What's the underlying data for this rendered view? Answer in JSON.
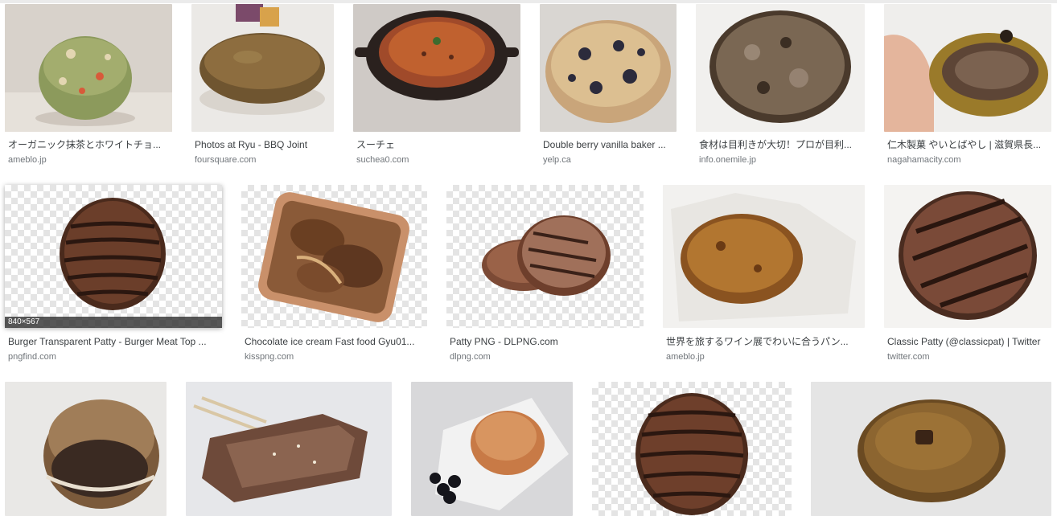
{
  "results": {
    "row1": [
      {
        "title": "オーガニック抹茶とホワイトチョ...",
        "domain": "ameblo.jp"
      },
      {
        "title": "Photos at Ryu - BBQ Joint",
        "domain": "foursquare.com"
      },
      {
        "title": "スーチェ",
        "domain": "suchea0.com"
      },
      {
        "title": "Double berry vanilla baker ...",
        "domain": "yelp.ca"
      },
      {
        "title": "食材は目利きが大切！プロが目利...",
        "domain": "info.onemile.jp"
      },
      {
        "title": "仁木製菓 やいとばやし | 滋賀県長...",
        "domain": "nagahamacity.com"
      }
    ],
    "row2": [
      {
        "title": "Burger Transparent Patty - Burger Meat Top ...",
        "domain": "pngfind.com",
        "dims": "840×567"
      },
      {
        "title": "Chocolate ice cream Fast food Gyu01...",
        "domain": "kisspng.com"
      },
      {
        "title": "Patty PNG - DLPNG.com",
        "domain": "dlpng.com"
      },
      {
        "title": "世界を旅するワイン展でわいに合うパン...",
        "domain": "ameblo.jp"
      },
      {
        "title": "Classic Patty (@classicpat) | Twitter",
        "domain": "twitter.com"
      }
    ]
  },
  "colors": {
    "title_text": "#3c4043",
    "domain_text": "#70757a",
    "dims_bar": "#323232"
  },
  "icons": [
    "food-thumbnail"
  ]
}
